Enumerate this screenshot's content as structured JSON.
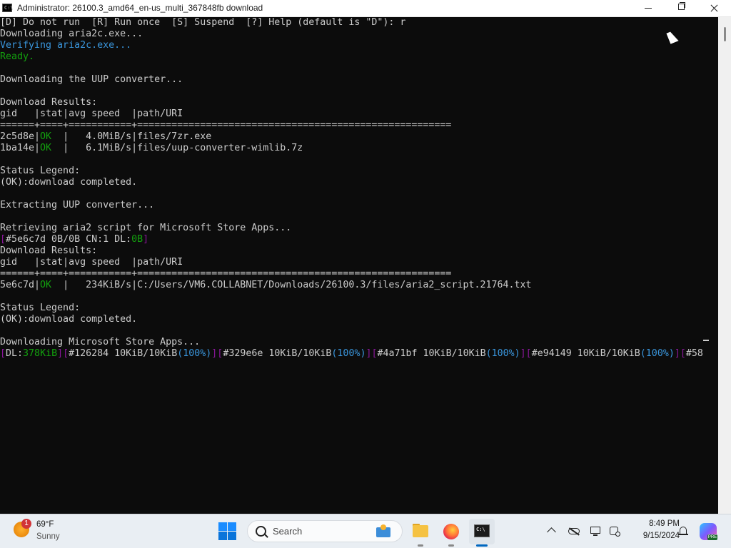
{
  "window": {
    "title": "Administrator:  26100.3_amd64_en-us_multi_367848fb download",
    "icon": "cmd-icon"
  },
  "console": {
    "lines": [
      [
        {
          "t": "[D] Do not run  [R] Run once  [S] Suspend  [?] Help (default is \"D\"): r"
        }
      ],
      [
        {
          "t": "Downloading aria2c.exe..."
        }
      ],
      [
        {
          "t": "Verifying aria2c.exe...",
          "c": "cyan"
        }
      ],
      [
        {
          "t": "Ready.",
          "c": "green"
        }
      ],
      [
        {
          "t": ""
        }
      ],
      [
        {
          "t": "Downloading the UUP converter..."
        }
      ],
      [
        {
          "t": ""
        }
      ],
      [
        {
          "t": "Download Results:"
        }
      ],
      [
        {
          "t": "gid   |stat|avg speed  |path/URI"
        }
      ],
      [
        {
          "t": "======+====+===========+======================================================="
        }
      ],
      [
        {
          "t": "2c5d8e|"
        },
        {
          "t": "OK",
          "c": "green"
        },
        {
          "t": "  |   4.0MiB/s|files/7zr.exe"
        }
      ],
      [
        {
          "t": "1ba14e|"
        },
        {
          "t": "OK",
          "c": "green"
        },
        {
          "t": "  |   6.1MiB/s|files/uup-converter-wimlib.7z"
        }
      ],
      [
        {
          "t": ""
        }
      ],
      [
        {
          "t": "Status Legend:"
        }
      ],
      [
        {
          "t": "(OK):download completed."
        }
      ],
      [
        {
          "t": ""
        }
      ],
      [
        {
          "t": "Extracting UUP converter..."
        }
      ],
      [
        {
          "t": ""
        }
      ],
      [
        {
          "t": "Retrieving aria2 script for Microsoft Store Apps..."
        }
      ],
      [
        {
          "t": "[",
          "c": "purple"
        },
        {
          "t": "#5e6c7d 0B/0B CN:1 DL:"
        },
        {
          "t": "0B",
          "c": "green"
        },
        {
          "t": "]",
          "c": "purple"
        }
      ],
      [
        {
          "t": "Download Results:"
        }
      ],
      [
        {
          "t": "gid   |stat|avg speed  |path/URI"
        }
      ],
      [
        {
          "t": "======+====+===========+======================================================="
        }
      ],
      [
        {
          "t": "5e6c7d|"
        },
        {
          "t": "OK",
          "c": "green"
        },
        {
          "t": "  |   234KiB/s|C:/Users/VM6.COLLABNET/Downloads/26100.3/files/aria2_script.21764.txt"
        }
      ],
      [
        {
          "t": ""
        }
      ],
      [
        {
          "t": "Status Legend:"
        }
      ],
      [
        {
          "t": "(OK):download completed."
        }
      ],
      [
        {
          "t": ""
        }
      ],
      [
        {
          "t": "Downloading Microsoft Store Apps..."
        }
      ],
      [
        {
          "t": "[",
          "c": "purple"
        },
        {
          "t": "DL:"
        },
        {
          "t": "378KiB",
          "c": "green"
        },
        {
          "t": "]",
          "c": "purple"
        },
        {
          "t": "[",
          "c": "purple"
        },
        {
          "t": "#126284 10KiB/10KiB"
        },
        {
          "t": "(100%)",
          "c": "cyan"
        },
        {
          "t": "]",
          "c": "purple"
        },
        {
          "t": "[",
          "c": "purple"
        },
        {
          "t": "#329e6e 10KiB/10KiB"
        },
        {
          "t": "(100%)",
          "c": "cyan"
        },
        {
          "t": "]",
          "c": "purple"
        },
        {
          "t": "[",
          "c": "purple"
        },
        {
          "t": "#4a71bf 10KiB/10KiB"
        },
        {
          "t": "(100%)",
          "c": "cyan"
        },
        {
          "t": "]",
          "c": "purple"
        },
        {
          "t": "[",
          "c": "purple"
        },
        {
          "t": "#e94149 10KiB/10KiB"
        },
        {
          "t": "(100%)",
          "c": "cyan"
        },
        {
          "t": "]",
          "c": "purple"
        },
        {
          "t": "[",
          "c": "purple"
        },
        {
          "t": "#58"
        }
      ]
    ]
  },
  "taskbar": {
    "weather": {
      "badge": "1",
      "temp": "69°F",
      "condition": "Sunny"
    },
    "search": {
      "label": "Search"
    },
    "apps": [
      {
        "name": "file-explorer",
        "icon": "folder-icon"
      },
      {
        "name": "firefox",
        "icon": "firefox-icon"
      },
      {
        "name": "terminal",
        "icon": "cmd-icon",
        "active": true
      }
    ],
    "clock": {
      "time": "8:49 PM",
      "date": "9/15/2024"
    },
    "copilot_badge": "PRE"
  },
  "colors": {
    "console_bg": "#0c0c0c",
    "console_text": "#cccccc",
    "green": "#13a10e",
    "cyan": "#3a96dd",
    "purple": "#881798",
    "taskbar_bg": "#e9eef3"
  }
}
